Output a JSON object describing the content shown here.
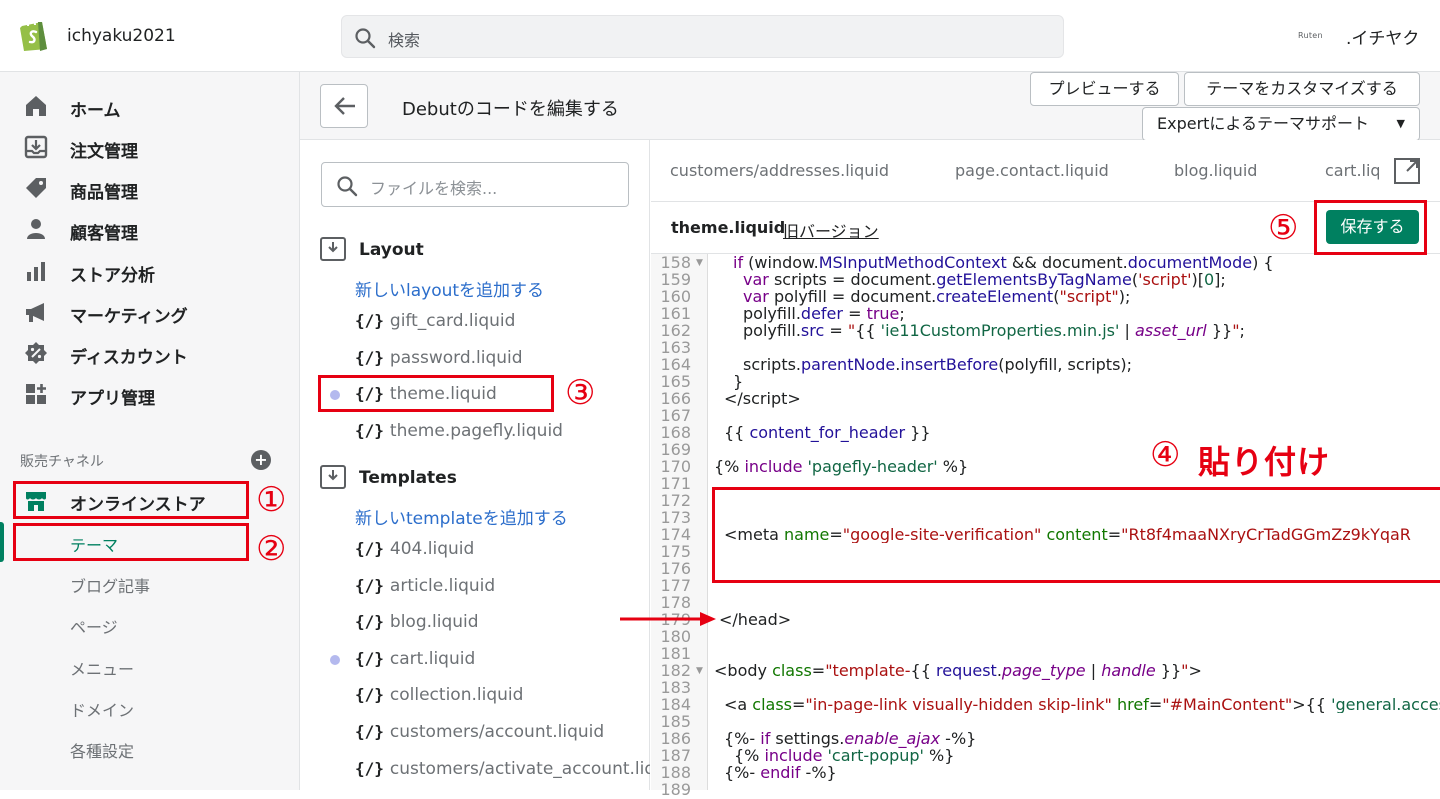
{
  "topbar": {
    "store_name": "ichyaku2021",
    "search_placeholder": "検索",
    "ruten_logo": "Ruten",
    "user_name": ".イチヤク"
  },
  "sidebar": {
    "items": [
      {
        "label": "ホーム",
        "icon": "home-icon"
      },
      {
        "label": "注文管理",
        "icon": "orders-icon"
      },
      {
        "label": "商品管理",
        "icon": "tag-icon"
      },
      {
        "label": "顧客管理",
        "icon": "person-icon"
      },
      {
        "label": "ストア分析",
        "icon": "bar-chart-icon"
      },
      {
        "label": "マーケティング",
        "icon": "megaphone-icon"
      },
      {
        "label": "ディスカウント",
        "icon": "discount-icon"
      },
      {
        "label": "アプリ管理",
        "icon": "apps-icon"
      }
    ],
    "channel_heading": "販売チャネル",
    "online_store": "オンラインストア",
    "subitems": [
      "テーマ",
      "ブログ記事",
      "ページ",
      "メニュー",
      "ドメイン",
      "各種設定"
    ]
  },
  "header": {
    "title": "Debutのコードを編集する",
    "preview": "プレビューする",
    "customize": "テーマをカスタマイズする",
    "expert": "Expertによるテーマサポート"
  },
  "files": {
    "search_placeholder": "ファイルを検索...",
    "layout_label": "Layout",
    "layout_add": "新しいlayoutを追加する",
    "layout_files": [
      "gift_card.liquid",
      "password.liquid",
      "theme.liquid",
      "theme.pagefly.liquid"
    ],
    "templates_label": "Templates",
    "templates_add": "新しいtemplateを追加する",
    "template_files": [
      "404.liquid",
      "article.liquid",
      "blog.liquid",
      "cart.liquid",
      "collection.liquid",
      "customers/account.liquid",
      "customers/activate_account.liquid"
    ],
    "bracket_icon": "{/}"
  },
  "editor": {
    "tabs": [
      "customers/addresses.liquid",
      "page.contact.liquid",
      "blog.liquid",
      "cart.liquid"
    ],
    "filename": "theme.liquid",
    "old_version": "旧バージョン",
    "save": "保存する",
    "line_numbers": [
      "158",
      "159",
      "160",
      "161",
      "162",
      "163",
      "164",
      "165",
      "166",
      "167",
      "168",
      "169",
      "170",
      "171",
      "172",
      "173",
      "174",
      "175",
      "176",
      "177",
      "178",
      "179",
      "180",
      "181",
      "182",
      "183",
      "184",
      "185",
      "186",
      "187",
      "188",
      "189"
    ]
  },
  "annotations": {
    "n1": "①",
    "n2": "②",
    "n3": "③",
    "n4": "④",
    "n5": "⑤",
    "paste": "貼り付け",
    "accent": "#e60012"
  },
  "colors": {
    "save": "#008060",
    "link": "#2c6ecb",
    "active": "#008060"
  }
}
